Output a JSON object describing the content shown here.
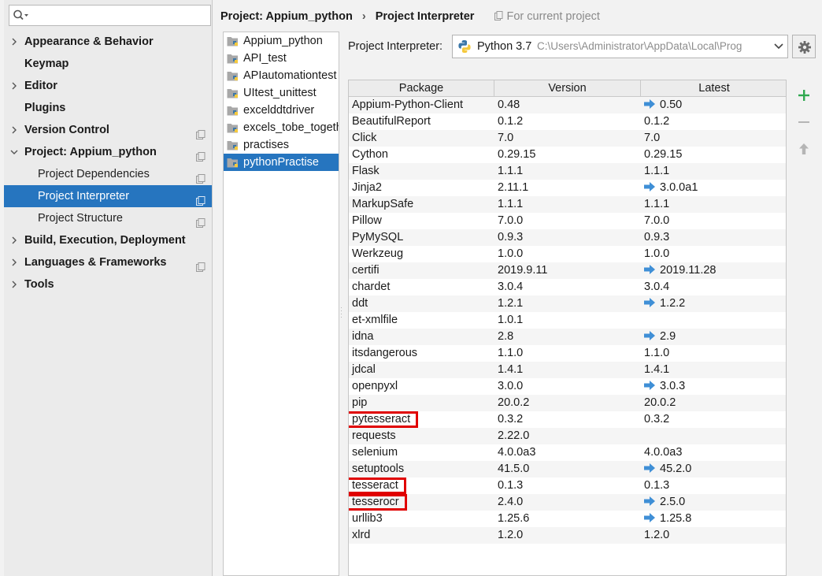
{
  "colors": {
    "selection": "#2675bf",
    "accent_add": "#2fa84f",
    "upgrade_arrow": "#3f8fd6",
    "highlight": "#e00000"
  },
  "search": {
    "placeholder": ""
  },
  "nav": [
    {
      "label": "Appearance & Behavior",
      "bold": true,
      "arrow": "right"
    },
    {
      "label": "Keymap",
      "bold": true
    },
    {
      "label": "Editor",
      "bold": true,
      "arrow": "right"
    },
    {
      "label": "Plugins",
      "bold": true
    },
    {
      "label": "Version Control",
      "bold": true,
      "arrow": "right",
      "icon": true
    },
    {
      "label": "Project: Appium_python",
      "bold": true,
      "arrow": "down",
      "icon": true
    },
    {
      "label": "Project Dependencies",
      "child": true,
      "icon": true
    },
    {
      "label": "Project Interpreter",
      "child": true,
      "icon": true,
      "selected": true
    },
    {
      "label": "Project Structure",
      "child": true,
      "icon": true
    },
    {
      "label": "Build, Execution, Deployment",
      "bold": true,
      "arrow": "right"
    },
    {
      "label": "Languages & Frameworks",
      "bold": true,
      "arrow": "right",
      "icon": true
    },
    {
      "label": "Tools",
      "bold": true,
      "arrow": "right"
    }
  ],
  "breadcrumb": {
    "project": "Project: Appium_python",
    "separator": "›",
    "page": "Project Interpreter",
    "hint": "For current project"
  },
  "projects": [
    {
      "label": "Appium_python"
    },
    {
      "label": "API_test"
    },
    {
      "label": "APIautomationtest"
    },
    {
      "label": "UItest_unittest"
    },
    {
      "label": "excelddtdriver"
    },
    {
      "label": "excels_tobe_together"
    },
    {
      "label": "practises"
    },
    {
      "label": "pythonPractise",
      "selected": true
    }
  ],
  "interpreter": {
    "label": "Project Interpreter:",
    "version": "Python 3.7",
    "path": "C:\\Users\\Administrator\\AppData\\Local\\Prog"
  },
  "table": {
    "headers": [
      "Package",
      "Version",
      "Latest"
    ],
    "rows": [
      {
        "package": "Appium-Python-Client",
        "version": "0.48",
        "latest": "0.50",
        "upgrade": true
      },
      {
        "package": "BeautifulReport",
        "version": "0.1.2",
        "latest": "0.1.2"
      },
      {
        "package": "Click",
        "version": "7.0",
        "latest": "7.0"
      },
      {
        "package": "Cython",
        "version": "0.29.15",
        "latest": "0.29.15"
      },
      {
        "package": "Flask",
        "version": "1.1.1",
        "latest": "1.1.1"
      },
      {
        "package": "Jinja2",
        "version": "2.11.1",
        "latest": "3.0.0a1",
        "upgrade": true
      },
      {
        "package": "MarkupSafe",
        "version": "1.1.1",
        "latest": "1.1.1"
      },
      {
        "package": "Pillow",
        "version": "7.0.0",
        "latest": "7.0.0"
      },
      {
        "package": "PyMySQL",
        "version": "0.9.3",
        "latest": "0.9.3"
      },
      {
        "package": "Werkzeug",
        "version": "1.0.0",
        "latest": "1.0.0"
      },
      {
        "package": "certifi",
        "version": "2019.9.11",
        "latest": "2019.11.28",
        "upgrade": true
      },
      {
        "package": "chardet",
        "version": "3.0.4",
        "latest": "3.0.4"
      },
      {
        "package": "ddt",
        "version": "1.2.1",
        "latest": "1.2.2",
        "upgrade": true
      },
      {
        "package": "et-xmlfile",
        "version": "1.0.1",
        "latest": ""
      },
      {
        "package": "idna",
        "version": "2.8",
        "latest": "2.9",
        "upgrade": true
      },
      {
        "package": "itsdangerous",
        "version": "1.1.0",
        "latest": "1.1.0"
      },
      {
        "package": "jdcal",
        "version": "1.4.1",
        "latest": "1.4.1"
      },
      {
        "package": "openpyxl",
        "version": "3.0.0",
        "latest": "3.0.3",
        "upgrade": true
      },
      {
        "package": "pip",
        "version": "20.0.2",
        "latest": "20.0.2"
      },
      {
        "package": "pytesseract",
        "version": "0.3.2",
        "latest": "0.3.2",
        "highlight": true
      },
      {
        "package": "requests",
        "version": "2.22.0",
        "latest": ""
      },
      {
        "package": "selenium",
        "version": "4.0.0a3",
        "latest": "4.0.0a3"
      },
      {
        "package": "setuptools",
        "version": "41.5.0",
        "latest": "45.2.0",
        "upgrade": true
      },
      {
        "package": "tesseract",
        "version": "0.1.3",
        "latest": "0.1.3",
        "highlight": true
      },
      {
        "package": "tesserocr",
        "version": "2.4.0",
        "latest": "2.5.0",
        "upgrade": true,
        "highlight": true
      },
      {
        "package": "urllib3",
        "version": "1.25.6",
        "latest": "1.25.8",
        "upgrade": true
      },
      {
        "package": "xlrd",
        "version": "1.2.0",
        "latest": "1.2.0"
      }
    ]
  },
  "tools": {
    "add": "plus-icon",
    "remove": "minus-icon",
    "upgrade": "up-arrow-icon"
  }
}
